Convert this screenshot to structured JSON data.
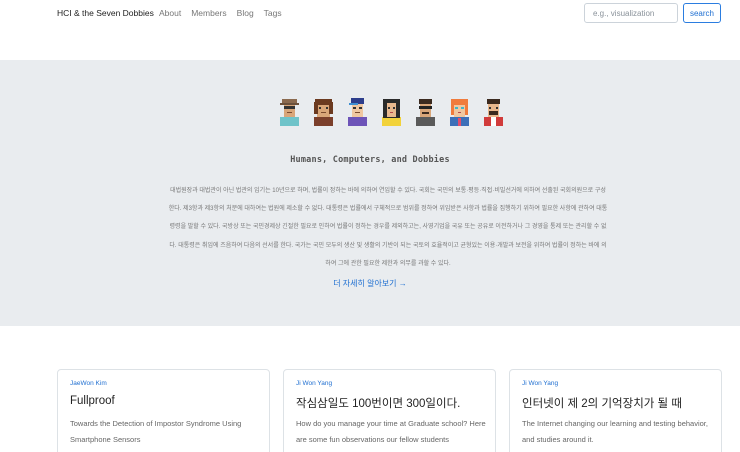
{
  "navbar": {
    "brand": "HCI & the Seven Dobbies",
    "links": [
      "About",
      "Members",
      "Blog",
      "Tags"
    ],
    "search_placeholder": "e.g., visualization",
    "search_button": "search"
  },
  "hero": {
    "title": "Humans, Computers, and Dobbies",
    "description": "대법원장과 대법관이 아닌 법관의 임기는 10년으로 하며, 법률이 정하는 바에 의하여 연임할 수 있다. 국회는 국민의 보통·평등·직접·비밀선거에 의하여 선출된 국회의원으로 구성한다. 제3항과 제3항의 처분에 대하여는 법원에 제소할 수 없다. 대통령은 법률에서 구체적으로 범위를 정하여 위임받은 사항과 법률을 집행하기 위하여 필요한 사항에 관하여 대통령령을 발할 수 있다. 국방상 또는 국민경제상 긴절한 필요로 인하여 법률이 정하는 경우를 제외하고는, 사영기업을 국유 또는 공유로 이전하거나 그 경영을 통제 또는 관리할 수 없다. 대통령은 취임에 즈음하여 다음의 선서를 한다. 국가는 국민 모두의 생산 및 생활의 기반이 되는 국토의 효율적이고 균형있는 이용·개발과 보전을 위하여 법률이 정하는 바에 의하여 그에 관한 필요한 제한과 의무를 과할 수 있다.",
    "more_link": "더 자세히 알아보기 →",
    "avatars": [
      "avatar-1",
      "avatar-2",
      "avatar-3",
      "avatar-4",
      "avatar-5",
      "avatar-6",
      "avatar-7"
    ]
  },
  "cards": [
    {
      "author": "JaeWon Kim",
      "title": "Fullproof",
      "description": "Towards the Detection of Impostor Syndrome Using Smartphone Sensors"
    },
    {
      "author": "Ji Won Yang",
      "title": "작심삼일도 100번이면 300일이다.",
      "description": "How do you manage your time at Graduate school? Here are some fun observations our fellow students"
    },
    {
      "author": "Ji Won Yang",
      "title": "인터넷이 제 2의 기억장치가 될 때",
      "description": "The Internet changing our learning and testing behavior, and studies around it."
    }
  ]
}
